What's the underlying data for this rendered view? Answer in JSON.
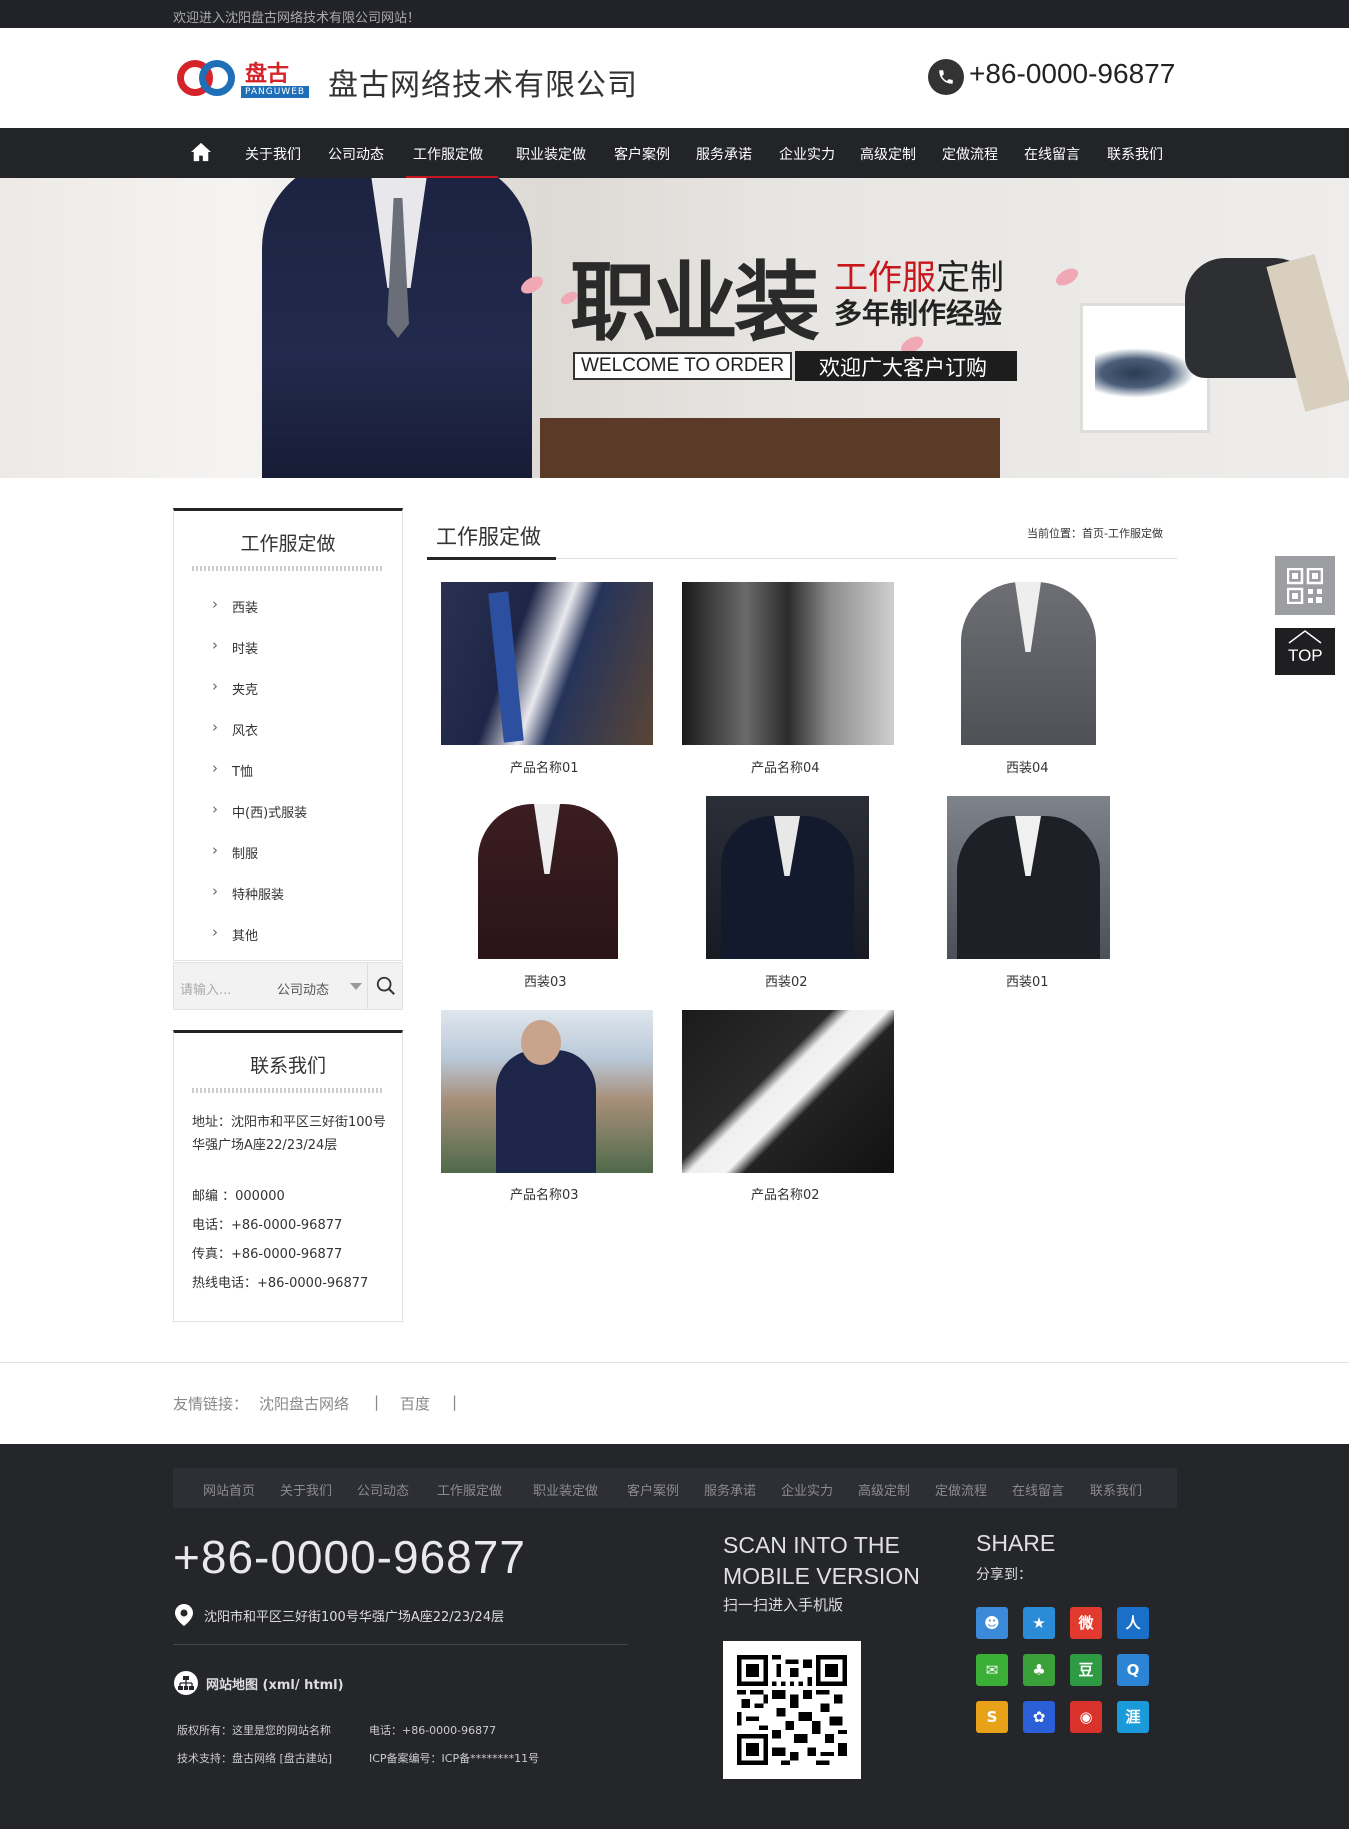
{
  "topbar": {
    "welcome": "欢迎进入沈阳盘古网络技术有限公司网站！"
  },
  "header": {
    "logo_cn": "盘古",
    "logo_en": "PANGUWEB",
    "company": "盘古网络技术有限公司",
    "phone": "+86-0000-96877"
  },
  "nav": {
    "items": [
      "关于我们",
      "公司动态",
      "工作服定做",
      "职业装定做",
      "客户案例",
      "服务承诺",
      "企业实力",
      "高级定制",
      "定做流程",
      "在线留言",
      "联系我们"
    ],
    "active": "工作服定做"
  },
  "banner": {
    "big": "职业装",
    "line1_red": "工作服",
    "line1_rest": "定制",
    "line2": "多年制作经验",
    "welcome": "WELCOME TO ORDER",
    "order": "欢迎广大客户订购"
  },
  "sidebar": {
    "title": "工作服定做",
    "categories": [
      "西装",
      "时装",
      "夹克",
      "风衣",
      "T恤",
      "中(西)式服装",
      "制服",
      "特种服装",
      "其他"
    ],
    "search": {
      "placeholder": "请输入...",
      "select": "公司动态"
    },
    "contact": {
      "title": "联系我们",
      "address": "地址：沈阳市和平区三好街100号华强广场A座22/23/24层",
      "postcode": "邮编 ：000000",
      "phone": "电话：+86-0000-96877",
      "fax": "传真：+86-0000-96877",
      "hotline": "热线电话：+86-0000-96877"
    }
  },
  "main": {
    "title": "工作服定做",
    "breadcrumb": "当前位置：首页-工作服定做",
    "products": [
      {
        "name": "产品名称01"
      },
      {
        "name": "产品名称04"
      },
      {
        "name": "西装04"
      },
      {
        "name": "西装03"
      },
      {
        "name": "西装02"
      },
      {
        "name": "西装01"
      },
      {
        "name": "产品名称03"
      },
      {
        "name": "产品名称02"
      }
    ]
  },
  "float": {
    "top_label": "TOP"
  },
  "links": {
    "label": "友情链接：",
    "items": [
      "沈阳盘古网络",
      "百度"
    ],
    "separator": "|"
  },
  "footer": {
    "nav": [
      "网站首页",
      "关于我们",
      "公司动态",
      "工作服定做",
      "职业装定做",
      "客户案例",
      "服务承诺",
      "企业实力",
      "高级定制",
      "定做流程",
      "在线留言",
      "联系我们"
    ],
    "phone": "+86-0000-96877",
    "address": "沈阳市和平区三好街100号华强广场A座22/23/24层",
    "sitemap": "网站地图 (xml/ html)",
    "copyright": "版权所有：这里是您的网站名称",
    "tel": "电话：+86-0000-96877",
    "support": "技术支持：盘古网络 [盘古建站]",
    "icp": "ICP备案编号：ICP备********11号",
    "scan_title_1": "SCAN INTO THE",
    "scan_title_2": "MOBILE VERSION",
    "scan_sub": "扫一扫进入手机版",
    "share_title": "SHARE",
    "share_sub": "分享到：",
    "share_icons": [
      {
        "name": "qzone-icon",
        "glyph": "☻",
        "color": "#3b8ad9"
      },
      {
        "name": "favorite-star-icon",
        "glyph": "★",
        "color": "#2a8bd6"
      },
      {
        "name": "weibo-icon",
        "glyph": "微",
        "color": "#e33a2f"
      },
      {
        "name": "renren-icon",
        "glyph": "人",
        "color": "#1a70c9"
      },
      {
        "name": "wechat-icon",
        "glyph": "✉",
        "color": "#3aae35"
      },
      {
        "name": "kaixin-clover-icon",
        "glyph": "♣",
        "color": "#3aa13a"
      },
      {
        "name": "douban-icon",
        "glyph": "豆",
        "color": "#2f9a44"
      },
      {
        "name": "qq-icon",
        "glyph": "Q",
        "color": "#2b84d4"
      },
      {
        "name": "sohu-icon",
        "glyph": "S",
        "color": "#e8a21a"
      },
      {
        "name": "baidu-paw-icon",
        "glyph": "✿",
        "color": "#2b5fd8"
      },
      {
        "name": "netease-icon",
        "glyph": "◉",
        "color": "#d9322a"
      },
      {
        "name": "tianya-icon",
        "glyph": "涯",
        "color": "#1a9ad9"
      }
    ]
  }
}
